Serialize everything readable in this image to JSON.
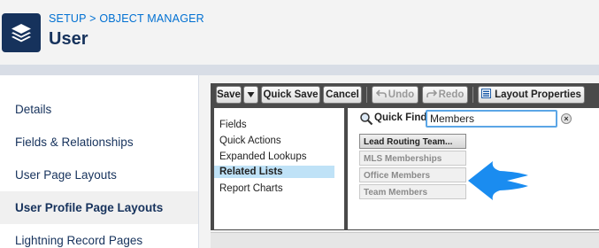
{
  "header": {
    "breadcrumb": [
      "SETUP",
      ">",
      "OBJECT MANAGER"
    ],
    "title": "User",
    "icon": "layers-icon"
  },
  "sidebar": {
    "items": [
      {
        "label": "Details",
        "active": false
      },
      {
        "label": "Fields & Relationships",
        "active": false
      },
      {
        "label": "User Page Layouts",
        "active": false
      },
      {
        "label": "User Profile Page Layouts",
        "active": true
      },
      {
        "label": "Lightning Record Pages",
        "active": false
      }
    ]
  },
  "toolbar": {
    "save_label": "Save",
    "quick_save_label": "Quick Save",
    "cancel_label": "Cancel",
    "undo_label": "Undo",
    "redo_label": "Redo",
    "layout_properties_label": "Layout Properties"
  },
  "palette": {
    "categories": [
      {
        "label": "Fields",
        "selected": false
      },
      {
        "label": "Quick Actions",
        "selected": false
      },
      {
        "label": "Expanded Lookups",
        "selected": false
      },
      {
        "label": "Related Lists",
        "selected": true
      },
      {
        "label": "Report Charts",
        "selected": false
      }
    ],
    "quick_find_label": "Quick Find",
    "quick_find_value": "Members",
    "items": [
      {
        "label": "Lead Routing Team...",
        "state": "available"
      },
      {
        "label": "MLS Memberships",
        "state": "used"
      },
      {
        "label": "Office Members",
        "state": "used"
      },
      {
        "label": "Team Members",
        "state": "used"
      }
    ]
  },
  "colors": {
    "accent": "#0070d2",
    "title": "#16325c",
    "arrow": "#1a8cf0",
    "palette_bg": "#4a4a4a"
  }
}
